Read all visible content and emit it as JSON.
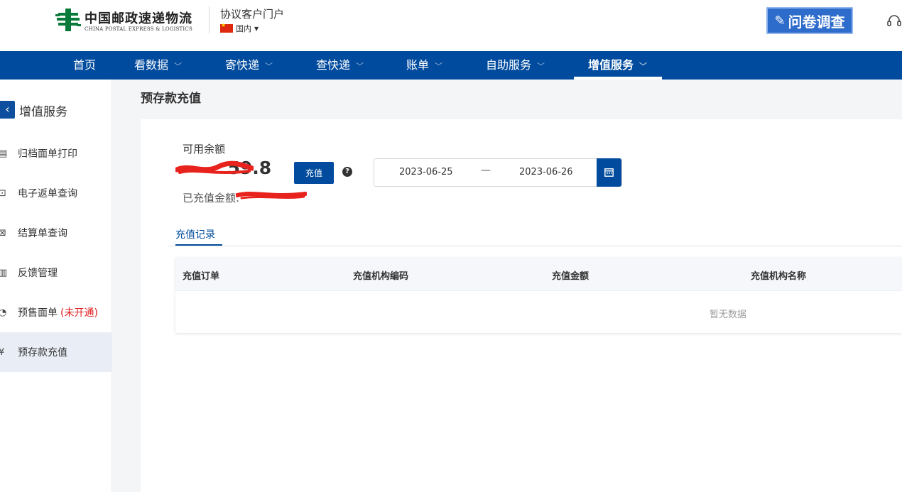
{
  "header": {
    "logo_cn": "中国邮政速递物流",
    "logo_en": "CHINA POSTAL EXPRESS & LOGISTICS",
    "portal_title": "协议客户门户",
    "region": "国内",
    "survey_label": "问卷调查",
    "brand_color": "#004b9e",
    "logo_color": "#0a7a3a"
  },
  "nav": {
    "items": [
      {
        "label": "首页"
      },
      {
        "label": "看数据"
      },
      {
        "label": "寄快递"
      },
      {
        "label": "查快递"
      },
      {
        "label": "账单"
      },
      {
        "label": "自助服务"
      },
      {
        "label": "增值服务"
      }
    ],
    "active": "增值服务"
  },
  "sidebar": {
    "title": "增值服务",
    "items": [
      {
        "label": "归档面单打印",
        "icon": "archive-print-icon"
      },
      {
        "label": "电子返单查询",
        "icon": "return-receipt-icon"
      },
      {
        "label": "结算单查询",
        "icon": "settlement-icon"
      },
      {
        "label": "反馈管理",
        "icon": "feedback-icon"
      },
      {
        "label": "预售面单",
        "note": "(未开通)",
        "icon": "presale-icon"
      },
      {
        "label": "预存款充值",
        "icon": "deposit-icon"
      }
    ],
    "active": "预存款充值"
  },
  "main": {
    "page_title": "预存款充值",
    "balance_label": "可用余额",
    "balance_visible": "59.8",
    "recharge_button": "充值",
    "recharged_label": "已充值金额:",
    "date_start": "2023-06-25",
    "date_separator": "—",
    "date_end": "2023-06-26",
    "tab_label": "充值记录",
    "table": {
      "columns": [
        "充值订单",
        "充值机构编码",
        "充值金额",
        "充值机构名称"
      ],
      "rows": [],
      "empty_text": "暂无数据"
    }
  }
}
